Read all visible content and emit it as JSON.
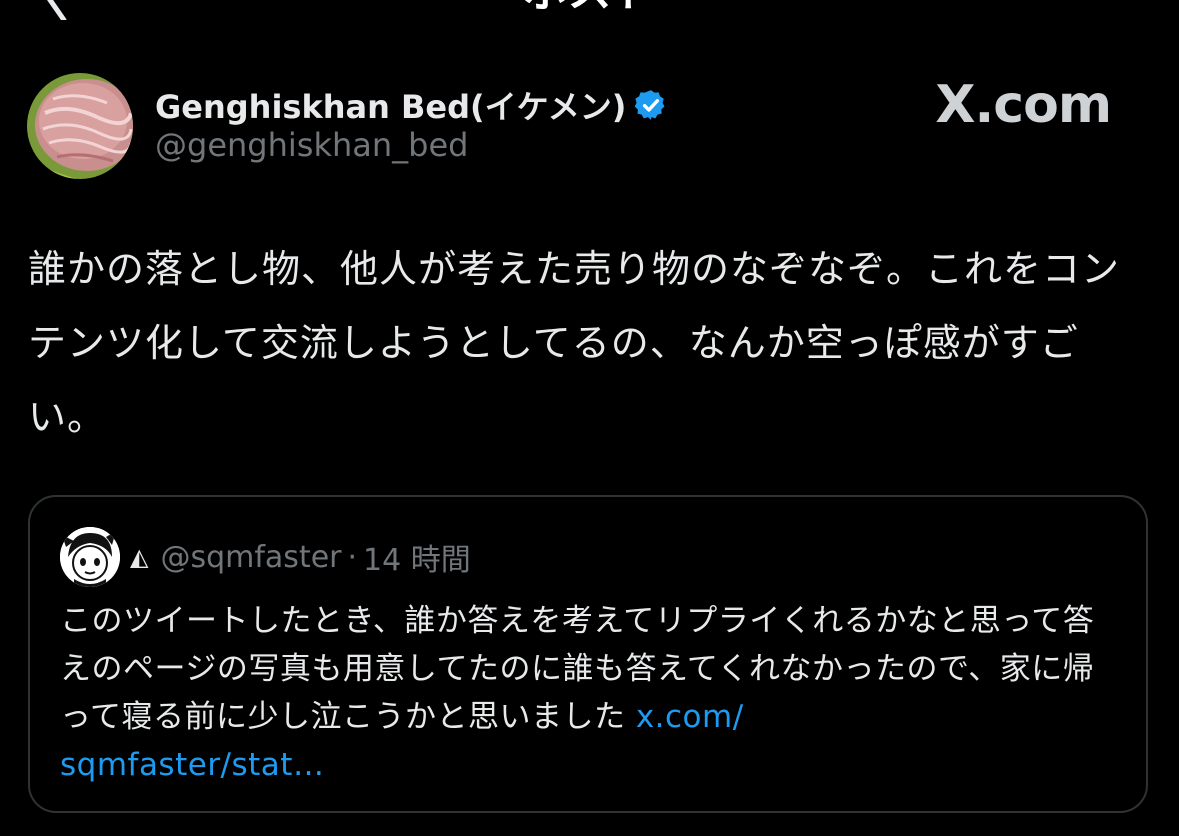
{
  "header": {
    "title": "ポスト",
    "back_icon": "chevron-left-icon"
  },
  "author": {
    "display_name": "Genghiskhan Bed(イケメン)",
    "handle": "@genghiskhan_bed",
    "verified": true,
    "verified_color": "#1d9bf0"
  },
  "watermark": {
    "text": "X.com"
  },
  "post": {
    "text": "誰かの落とし物、他人が考えた売り物のなぞなぞ。これをコンテンツ化して交流しようとしてるの、なんか空っぽ感がすごい。"
  },
  "quoted_post": {
    "badge": "◭",
    "handle": "@sqmfaster",
    "separator": "·",
    "time": "14 時間",
    "text": "このツイートしたとき、誰か答えを考えてリプライくれるかなと思って答えのページの写真も用意してたのに誰も答えてくれなかったので、家に帰って寝る前に少し泣こうかと思いました ",
    "link_text": "x.com/\nsqmfaster/stat…",
    "link_color": "#1d9bf0"
  },
  "colors": {
    "background": "#000000",
    "text": "#e7e9ea",
    "muted": "#71767b",
    "border": "#2f3336"
  }
}
